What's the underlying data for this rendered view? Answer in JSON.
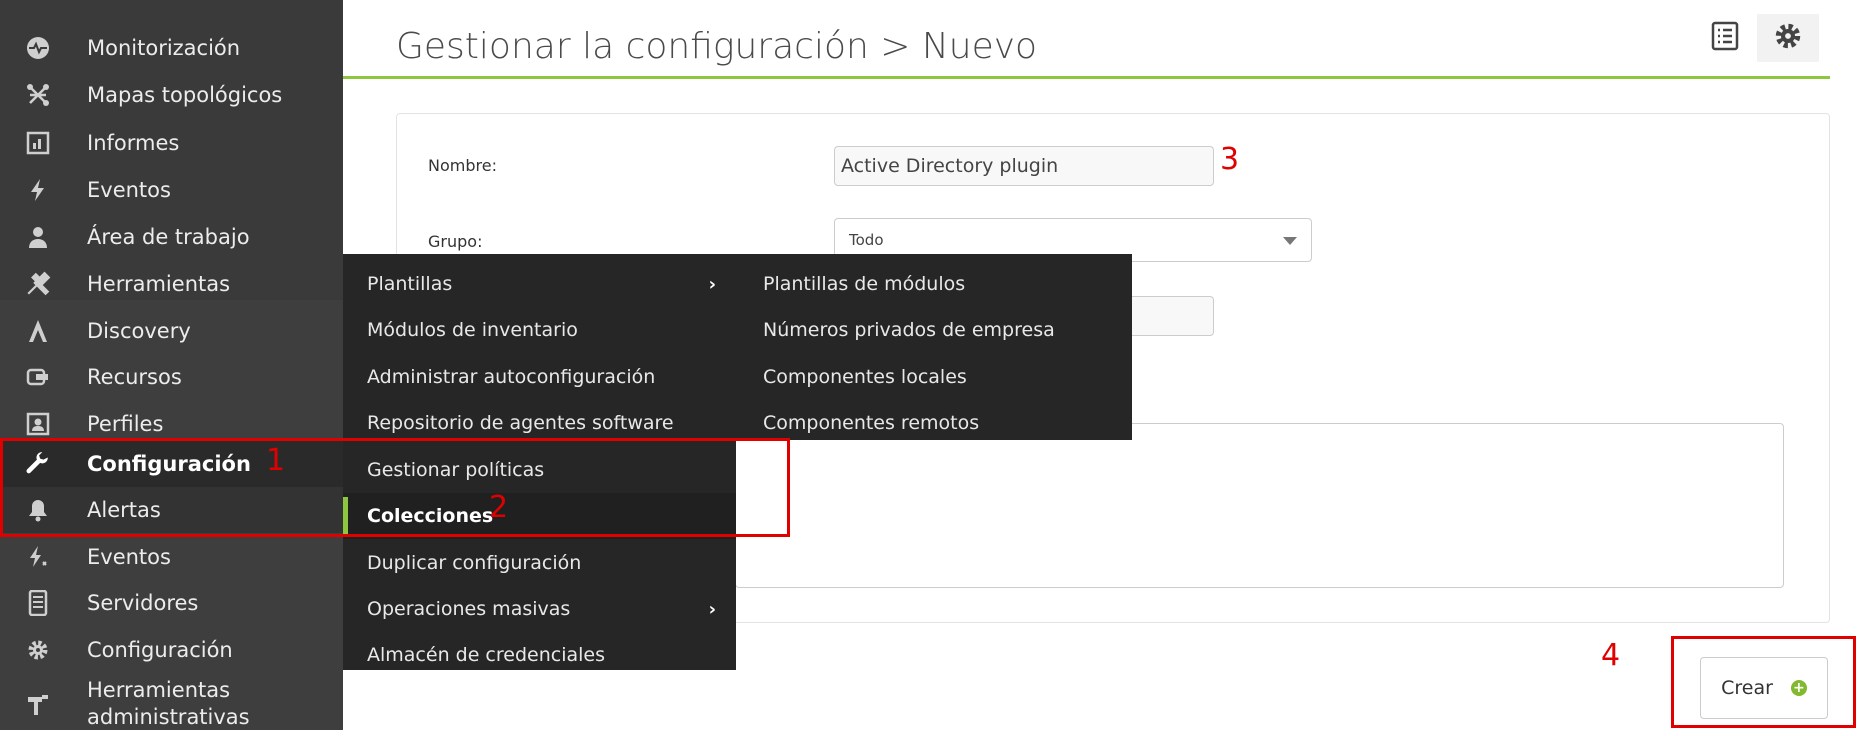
{
  "sidebar": {
    "items": [
      {
        "label": "Monitorización",
        "icon": "heartbeat-icon"
      },
      {
        "label": "Mapas topológicos",
        "icon": "network-map-icon"
      },
      {
        "label": "Informes",
        "icon": "report-icon"
      },
      {
        "label": "Eventos",
        "icon": "lightning-icon"
      },
      {
        "label": "Área de trabajo",
        "icon": "user-icon"
      },
      {
        "label": "Herramientas",
        "icon": "tools-icon"
      },
      {
        "label": "Discovery",
        "icon": "discovery-icon"
      },
      {
        "label": "Recursos",
        "icon": "resources-icon"
      },
      {
        "label": "Perfiles",
        "icon": "profile-icon"
      },
      {
        "label": "Configuración",
        "icon": "wrench-icon"
      },
      {
        "label": "Alertas",
        "icon": "bell-icon"
      },
      {
        "label": "Eventos",
        "icon": "event-lightning-icon"
      },
      {
        "label": "Servidores",
        "icon": "server-icon"
      },
      {
        "label": "Configuración",
        "icon": "gear-icon"
      },
      {
        "label": "Herramientas administrativas",
        "icon": "admin-tools-icon"
      }
    ]
  },
  "header": {
    "title": "Gestionar la configuración > Nuevo",
    "list_icon": "list-icon",
    "settings_icon": "gear-icon"
  },
  "form": {
    "name_label": "Nombre:",
    "name_value": "Active Directory plugin",
    "group_label": "Grupo:",
    "group_value": "Todo"
  },
  "menu": {
    "items": [
      {
        "label": "Plantillas"
      },
      {
        "label": "Módulos de inventario"
      },
      {
        "label": "Administrar autoconfiguración"
      },
      {
        "label": "Repositorio de agentes software"
      },
      {
        "label": "Gestionar políticas"
      },
      {
        "label": "Colecciones"
      },
      {
        "label": "Duplicar configuración"
      },
      {
        "label": "Operaciones masivas"
      },
      {
        "label": "Almacén de credenciales"
      }
    ],
    "submenu": [
      {
        "label": "Plantillas de módulos"
      },
      {
        "label": "Números privados de empresa"
      },
      {
        "label": "Componentes locales"
      },
      {
        "label": "Componentes remotos"
      }
    ]
  },
  "annotations": {
    "a1": "1",
    "a2": "2",
    "a3": "3",
    "a4": "4"
  },
  "actions": {
    "create_label": "Crear"
  },
  "colors": {
    "accent": "#8dc63f",
    "annotation": "#e00000",
    "sidebar": "#3e3e3e",
    "menu": "#262626"
  }
}
